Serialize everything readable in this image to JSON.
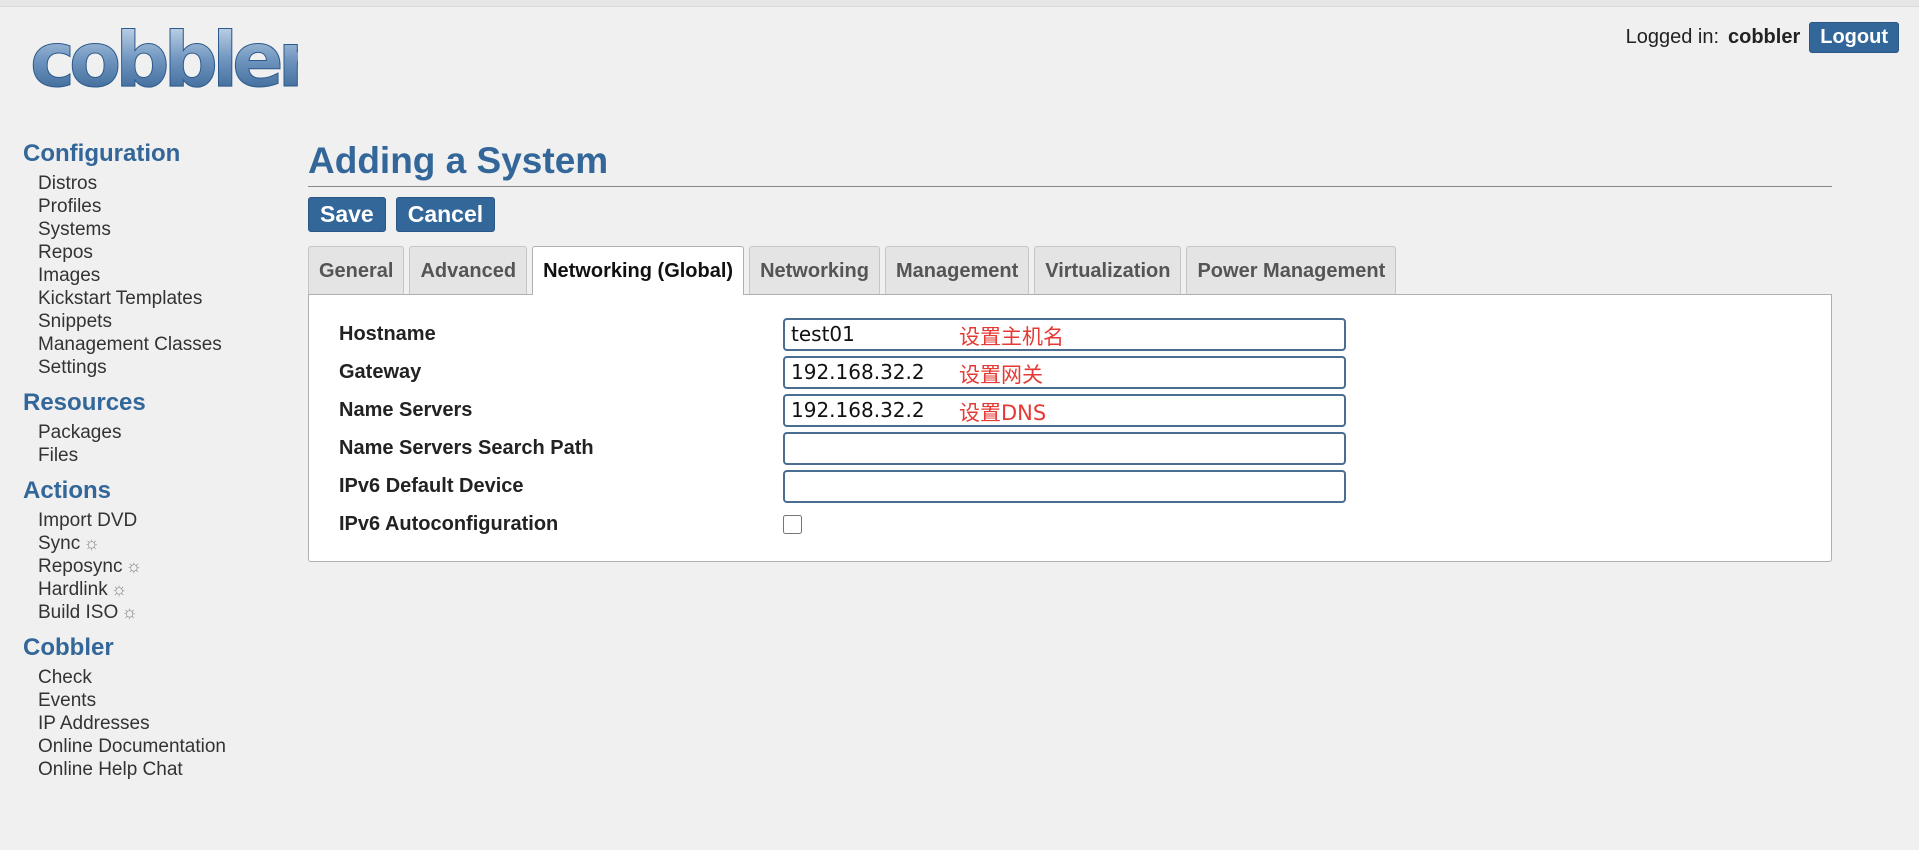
{
  "header": {
    "logo_text": "cobbler",
    "logged_in_label": "Logged in:",
    "username": "cobbler",
    "logout_label": "Logout"
  },
  "sidebar": {
    "sections": [
      {
        "title": "Configuration",
        "items": [
          "Distros",
          "Profiles",
          "Systems",
          "Repos",
          "Images",
          "Kickstart Templates",
          "Snippets",
          "Management Classes",
          "Settings"
        ]
      },
      {
        "title": "Resources",
        "items": [
          "Packages",
          "Files"
        ]
      },
      {
        "title": "Actions",
        "items": [
          "Import DVD",
          "Sync",
          "Reposync",
          "Hardlink",
          "Build ISO"
        ]
      },
      {
        "title": "Cobbler",
        "items": [
          "Check",
          "Events",
          "IP Addresses",
          "Online Documentation",
          "Online Help Chat"
        ]
      }
    ],
    "action_icon_glyph": "☼"
  },
  "main": {
    "title": "Adding a System",
    "save_label": "Save",
    "cancel_label": "Cancel",
    "tabs": [
      "General",
      "Advanced",
      "Networking (Global)",
      "Networking",
      "Management",
      "Virtualization",
      "Power Management"
    ],
    "active_tab": "Networking (Global)",
    "form": {
      "hostname": {
        "label": "Hostname",
        "value": "test01",
        "note": "设置主机名"
      },
      "gateway": {
        "label": "Gateway",
        "value": "192.168.32.2",
        "note": "设置网关"
      },
      "name_servers": {
        "label": "Name Servers",
        "value": "192.168.32.2",
        "note": "设置DNS"
      },
      "search_path": {
        "label": "Name Servers Search Path",
        "value": ""
      },
      "ipv6_device": {
        "label": "IPv6 Default Device",
        "value": ""
      },
      "ipv6_autoconf": {
        "label": "IPv6 Autoconfiguration",
        "checked": false
      }
    }
  },
  "colors": {
    "accent": "#336699",
    "annotation": "#e53935",
    "background": "#f0f0f0"
  }
}
